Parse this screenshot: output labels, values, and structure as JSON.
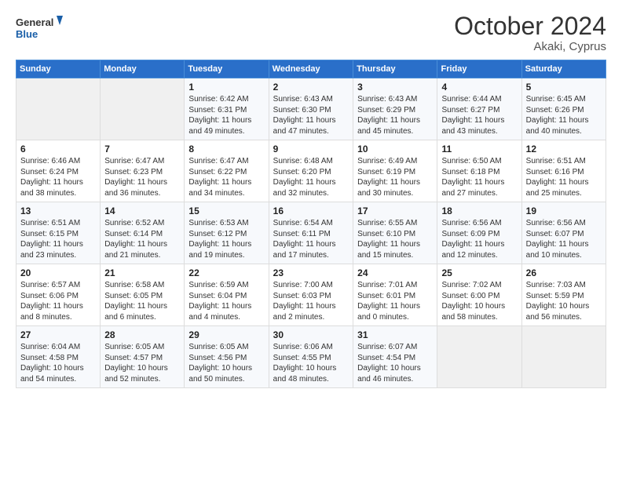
{
  "header": {
    "logo_line1": "General",
    "logo_line2": "Blue",
    "month_title": "October 2024",
    "location": "Akaki, Cyprus"
  },
  "weekdays": [
    "Sunday",
    "Monday",
    "Tuesday",
    "Wednesday",
    "Thursday",
    "Friday",
    "Saturday"
  ],
  "weeks": [
    [
      {
        "day": "",
        "detail": ""
      },
      {
        "day": "",
        "detail": ""
      },
      {
        "day": "1",
        "detail": "Sunrise: 6:42 AM\nSunset: 6:31 PM\nDaylight: 11 hours and 49 minutes."
      },
      {
        "day": "2",
        "detail": "Sunrise: 6:43 AM\nSunset: 6:30 PM\nDaylight: 11 hours and 47 minutes."
      },
      {
        "day": "3",
        "detail": "Sunrise: 6:43 AM\nSunset: 6:29 PM\nDaylight: 11 hours and 45 minutes."
      },
      {
        "day": "4",
        "detail": "Sunrise: 6:44 AM\nSunset: 6:27 PM\nDaylight: 11 hours and 43 minutes."
      },
      {
        "day": "5",
        "detail": "Sunrise: 6:45 AM\nSunset: 6:26 PM\nDaylight: 11 hours and 40 minutes."
      }
    ],
    [
      {
        "day": "6",
        "detail": "Sunrise: 6:46 AM\nSunset: 6:24 PM\nDaylight: 11 hours and 38 minutes."
      },
      {
        "day": "7",
        "detail": "Sunrise: 6:47 AM\nSunset: 6:23 PM\nDaylight: 11 hours and 36 minutes."
      },
      {
        "day": "8",
        "detail": "Sunrise: 6:47 AM\nSunset: 6:22 PM\nDaylight: 11 hours and 34 minutes."
      },
      {
        "day": "9",
        "detail": "Sunrise: 6:48 AM\nSunset: 6:20 PM\nDaylight: 11 hours and 32 minutes."
      },
      {
        "day": "10",
        "detail": "Sunrise: 6:49 AM\nSunset: 6:19 PM\nDaylight: 11 hours and 30 minutes."
      },
      {
        "day": "11",
        "detail": "Sunrise: 6:50 AM\nSunset: 6:18 PM\nDaylight: 11 hours and 27 minutes."
      },
      {
        "day": "12",
        "detail": "Sunrise: 6:51 AM\nSunset: 6:16 PM\nDaylight: 11 hours and 25 minutes."
      }
    ],
    [
      {
        "day": "13",
        "detail": "Sunrise: 6:51 AM\nSunset: 6:15 PM\nDaylight: 11 hours and 23 minutes."
      },
      {
        "day": "14",
        "detail": "Sunrise: 6:52 AM\nSunset: 6:14 PM\nDaylight: 11 hours and 21 minutes."
      },
      {
        "day": "15",
        "detail": "Sunrise: 6:53 AM\nSunset: 6:12 PM\nDaylight: 11 hours and 19 minutes."
      },
      {
        "day": "16",
        "detail": "Sunrise: 6:54 AM\nSunset: 6:11 PM\nDaylight: 11 hours and 17 minutes."
      },
      {
        "day": "17",
        "detail": "Sunrise: 6:55 AM\nSunset: 6:10 PM\nDaylight: 11 hours and 15 minutes."
      },
      {
        "day": "18",
        "detail": "Sunrise: 6:56 AM\nSunset: 6:09 PM\nDaylight: 11 hours and 12 minutes."
      },
      {
        "day": "19",
        "detail": "Sunrise: 6:56 AM\nSunset: 6:07 PM\nDaylight: 11 hours and 10 minutes."
      }
    ],
    [
      {
        "day": "20",
        "detail": "Sunrise: 6:57 AM\nSunset: 6:06 PM\nDaylight: 11 hours and 8 minutes."
      },
      {
        "day": "21",
        "detail": "Sunrise: 6:58 AM\nSunset: 6:05 PM\nDaylight: 11 hours and 6 minutes."
      },
      {
        "day": "22",
        "detail": "Sunrise: 6:59 AM\nSunset: 6:04 PM\nDaylight: 11 hours and 4 minutes."
      },
      {
        "day": "23",
        "detail": "Sunrise: 7:00 AM\nSunset: 6:03 PM\nDaylight: 11 hours and 2 minutes."
      },
      {
        "day": "24",
        "detail": "Sunrise: 7:01 AM\nSunset: 6:01 PM\nDaylight: 11 hours and 0 minutes."
      },
      {
        "day": "25",
        "detail": "Sunrise: 7:02 AM\nSunset: 6:00 PM\nDaylight: 10 hours and 58 minutes."
      },
      {
        "day": "26",
        "detail": "Sunrise: 7:03 AM\nSunset: 5:59 PM\nDaylight: 10 hours and 56 minutes."
      }
    ],
    [
      {
        "day": "27",
        "detail": "Sunrise: 6:04 AM\nSunset: 4:58 PM\nDaylight: 10 hours and 54 minutes."
      },
      {
        "day": "28",
        "detail": "Sunrise: 6:05 AM\nSunset: 4:57 PM\nDaylight: 10 hours and 52 minutes."
      },
      {
        "day": "29",
        "detail": "Sunrise: 6:05 AM\nSunset: 4:56 PM\nDaylight: 10 hours and 50 minutes."
      },
      {
        "day": "30",
        "detail": "Sunrise: 6:06 AM\nSunset: 4:55 PM\nDaylight: 10 hours and 48 minutes."
      },
      {
        "day": "31",
        "detail": "Sunrise: 6:07 AM\nSunset: 4:54 PM\nDaylight: 10 hours and 46 minutes."
      },
      {
        "day": "",
        "detail": ""
      },
      {
        "day": "",
        "detail": ""
      }
    ]
  ]
}
